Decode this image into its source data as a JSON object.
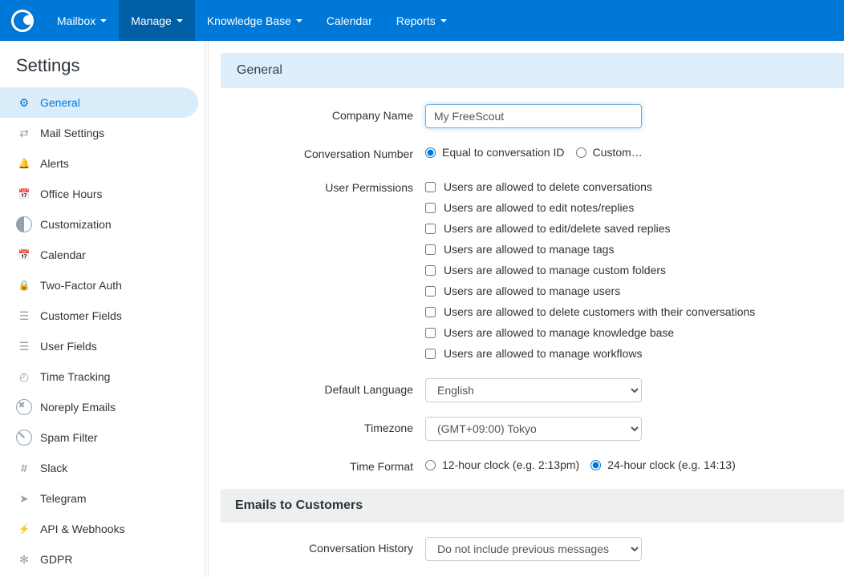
{
  "nav": {
    "items": [
      {
        "label": "Mailbox",
        "caret": true,
        "active": false
      },
      {
        "label": "Manage",
        "caret": true,
        "active": true
      },
      {
        "label": "Knowledge Base",
        "caret": true,
        "active": false
      },
      {
        "label": "Calendar",
        "caret": false,
        "active": false
      },
      {
        "label": "Reports",
        "caret": true,
        "active": false
      }
    ]
  },
  "sidebar": {
    "title": "Settings",
    "items": [
      {
        "label": "General",
        "icon": "gear-icon",
        "active": true
      },
      {
        "label": "Mail Settings",
        "icon": "swap-icon",
        "active": false
      },
      {
        "label": "Alerts",
        "icon": "bell-icon",
        "active": false
      },
      {
        "label": "Office Hours",
        "icon": "calendar-icon",
        "active": false
      },
      {
        "label": "Customization",
        "icon": "half-circle-icon",
        "active": false
      },
      {
        "label": "Calendar",
        "icon": "calendar-icon",
        "active": false
      },
      {
        "label": "Two-Factor Auth",
        "icon": "lock-icon",
        "active": false
      },
      {
        "label": "Customer Fields",
        "icon": "document-icon",
        "active": false
      },
      {
        "label": "User Fields",
        "icon": "document-icon",
        "active": false
      },
      {
        "label": "Time Tracking",
        "icon": "clock-icon",
        "active": false
      },
      {
        "label": "Noreply Emails",
        "icon": "x-circle-icon",
        "active": false
      },
      {
        "label": "Spam Filter",
        "icon": "ban-icon",
        "active": false
      },
      {
        "label": "Slack",
        "icon": "hash-icon",
        "active": false
      },
      {
        "label": "Telegram",
        "icon": "plane-icon",
        "active": false
      },
      {
        "label": "API & Webhooks",
        "icon": "bolt-icon",
        "active": false
      },
      {
        "label": "GDPR",
        "icon": "asterisk-icon",
        "active": false
      }
    ]
  },
  "page": {
    "heading": "General",
    "section_emails": "Emails to Customers"
  },
  "form": {
    "company_name_label": "Company Name",
    "company_name_value": "My FreeScout",
    "conv_number_label": "Conversation Number",
    "conv_number_opts": [
      "Equal to conversation ID",
      "Custom…"
    ],
    "conv_number_selected": 0,
    "user_perm_label": "User Permissions",
    "user_perm_opts": [
      "Users are allowed to delete conversations",
      "Users are allowed to edit notes/replies",
      "Users are allowed to edit/delete saved replies",
      "Users are allowed to manage tags",
      "Users are allowed to manage custom folders",
      "Users are allowed to manage users",
      "Users are allowed to delete customers with their conversations",
      "Users are allowed to manage knowledge base",
      "Users are allowed to manage workflows"
    ],
    "default_lang_label": "Default Language",
    "default_lang_value": "English",
    "timezone_label": "Timezone",
    "timezone_value": "(GMT+09:00) Tokyo",
    "time_format_label": "Time Format",
    "time_format_opts": [
      "12-hour clock (e.g. 2:13pm)",
      "24-hour clock (e.g. 14:13)"
    ],
    "time_format_selected": 1,
    "conv_history_label": "Conversation History",
    "conv_history_value": "Do not include previous messages"
  }
}
